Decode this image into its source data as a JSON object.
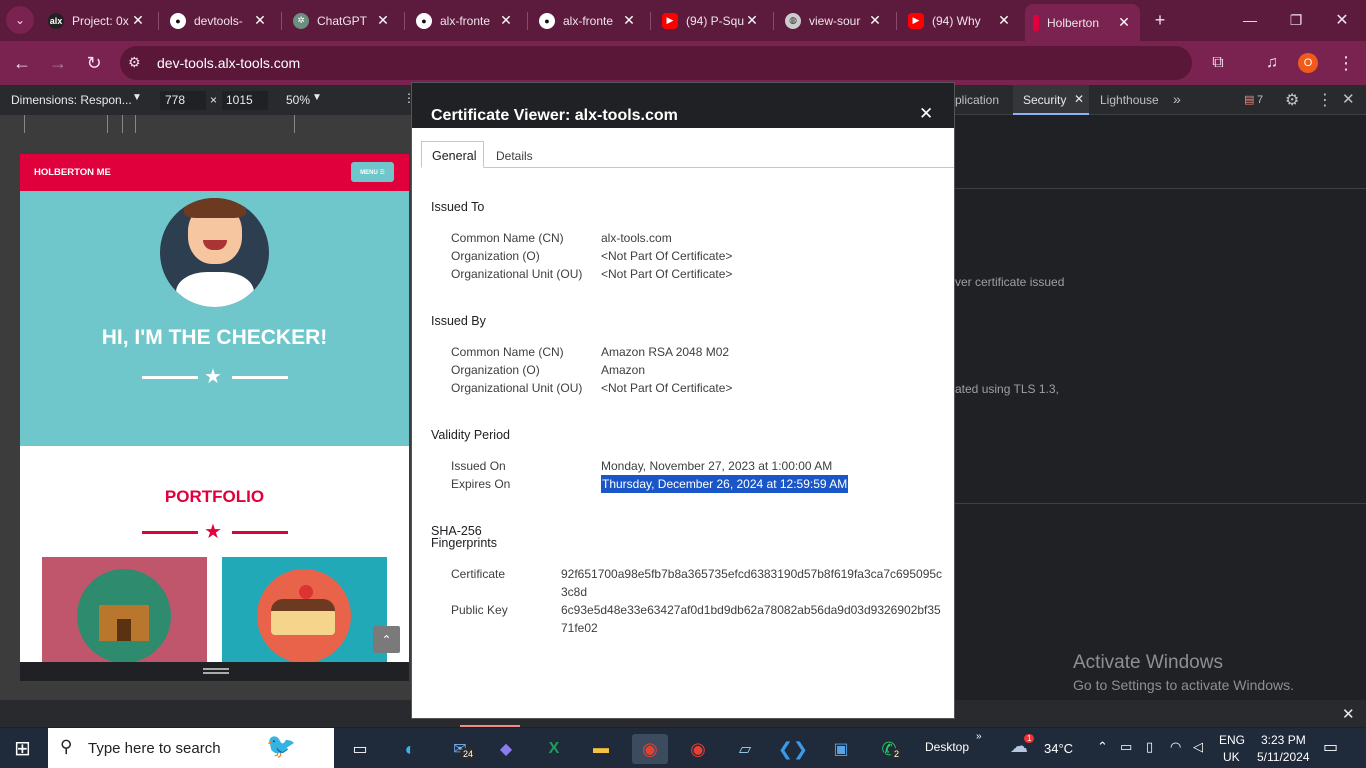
{
  "browser": {
    "tabs": [
      {
        "title": "Project: 0x",
        "favicon": "alx-icon",
        "color": "#1a1a1a"
      },
      {
        "title": "devtools-",
        "favicon": "github-icon",
        "color": "#1a1a1a"
      },
      {
        "title": "ChatGPT",
        "favicon": "chatgpt-icon",
        "color": "#10a37f"
      },
      {
        "title": "alx-fronte",
        "favicon": "github-icon",
        "color": "#1a1a1a"
      },
      {
        "title": "alx-fronte",
        "favicon": "github-icon",
        "color": "#1a1a1a"
      },
      {
        "title": "(94) P-Squ",
        "favicon": "youtube-icon",
        "color": "#ff0000"
      },
      {
        "title": "view-sour",
        "favicon": "globe-icon",
        "color": "#888888"
      },
      {
        "title": "(94) Why",
        "favicon": "youtube-icon",
        "color": "#ff0000"
      },
      {
        "title": "Holberton",
        "favicon": "holberton-icon",
        "color": "#e0003c"
      }
    ],
    "url": "dev-tools.alx-tools.com",
    "profile_initial": "O"
  },
  "device_toolbar": {
    "dimensions_label": "Dimensions: Respon...",
    "width": "778",
    "times": "×",
    "height": "1015",
    "zoom": "50%"
  },
  "page": {
    "brand": "HOLBERTON ME",
    "menu_label": "MENU ☰",
    "hero_title": "HI, I'M THE CHECKER!",
    "portfolio_title": "PORTFOLIO"
  },
  "devtools": {
    "tabs": [
      "plication",
      "Security",
      "Lighthouse"
    ],
    "active_tab": "Security",
    "issues_count": "7",
    "text_fragment_1": "ver certificate issued",
    "text_fragment_2": "ated using TLS 1.3,"
  },
  "cert": {
    "title": "Certificate Viewer: alx-tools.com",
    "tab_general": "General",
    "tab_details": "Details",
    "issued_to": {
      "heading": "Issued To",
      "rows": [
        {
          "label": "Common Name (CN)",
          "value": "alx-tools.com"
        },
        {
          "label": "Organization (O)",
          "value": "<Not Part Of Certificate>"
        },
        {
          "label": "Organizational Unit (OU)",
          "value": "<Not Part Of Certificate>"
        }
      ]
    },
    "issued_by": {
      "heading": "Issued By",
      "rows": [
        {
          "label": "Common Name (CN)",
          "value": "Amazon RSA 2048 M02"
        },
        {
          "label": "Organization (O)",
          "value": "Amazon"
        },
        {
          "label": "Organizational Unit (OU)",
          "value": "<Not Part Of Certificate>"
        }
      ]
    },
    "validity": {
      "heading": "Validity Period",
      "issued_on_label": "Issued On",
      "issued_on": "Monday, November 27, 2023 at 1:00:00 AM",
      "expires_on_label": "Expires On",
      "expires_on": "Thursday, December 26, 2024 at 12:59:59 AM"
    },
    "fingerprints": {
      "heading_1": "SHA-256",
      "heading_2": "Fingerprints",
      "certificate_label": "Certificate",
      "certificate_1": "92f651700a98e5fb7b8a365735efcd6383190d57b8f619fa3ca7c695095c",
      "certificate_2": "3c8d",
      "public_key_label": "Public Key",
      "public_key_1": "6c93e5d48e33e63427af0d1bd9db62a78082ab56da9d03d9326902bf35",
      "public_key_2": "71fe02"
    }
  },
  "watermark": {
    "line1": "Activate Windows",
    "line2": "Go to Settings to activate Windows."
  },
  "taskbar": {
    "search_placeholder": "Type here to search",
    "mail_badge": "24",
    "whatsapp_badge": "2",
    "desktop_label": "Desktop",
    "weather_temp": "34°C",
    "weather_badge": "1",
    "lang": "ENG",
    "region": "UK",
    "time": "3:23 PM",
    "date": "5/11/2024"
  }
}
